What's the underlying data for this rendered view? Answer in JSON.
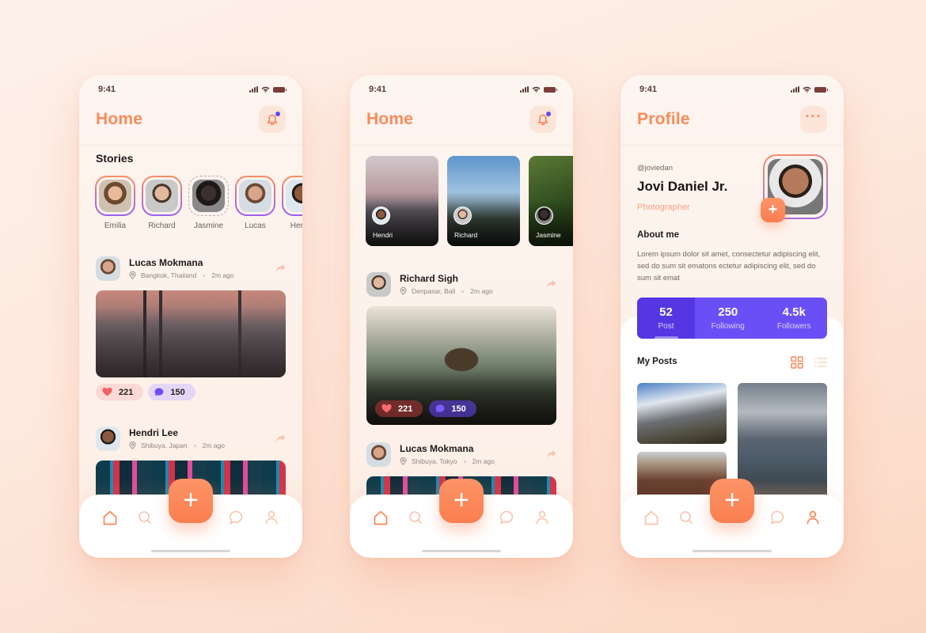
{
  "status_bar": {
    "time": "9:41"
  },
  "colors": {
    "accent": "#fa8a5c",
    "purple": "#6a4ff7",
    "like_bg": "#fbdad5",
    "comment_bg": "#e4d6f6"
  },
  "screens": [
    {
      "title": "Home",
      "stories_title": "Stories",
      "stories": [
        {
          "name": "Emilia",
          "seen": false
        },
        {
          "name": "Richard",
          "seen": false
        },
        {
          "name": "Jasmine",
          "seen": true
        },
        {
          "name": "Lucas",
          "seen": false
        },
        {
          "name": "Hendri",
          "seen": false
        }
      ],
      "posts": [
        {
          "author": "Lucas Mokmana",
          "location": "Bangkok, Thailand",
          "time": "2m ago",
          "likes": "221",
          "comments": "150"
        },
        {
          "author": "Hendri Lee",
          "location": "Shibuya, Japan",
          "time": "2m ago"
        }
      ]
    },
    {
      "title": "Home",
      "story_cards": [
        {
          "name": "Hendri"
        },
        {
          "name": "Richard"
        },
        {
          "name": "Jasmine"
        }
      ],
      "posts": [
        {
          "author": "Richard Sigh",
          "location": "Denpasar, Bali",
          "time": "2m ago",
          "likes": "221",
          "comments": "150"
        },
        {
          "author": "Lucas Mokmana",
          "location": "Shibuya, Tokyo",
          "time": "2m ago"
        }
      ]
    },
    {
      "title": "Profile",
      "handle": "@joviedan",
      "name": "Jovi Daniel Jr.",
      "role": "Photographer",
      "about_title": "About me",
      "about_text": "Lorem ipsum dolor sit amet, consectetur adipiscing elit, sed do sum sit ematons ectetur adipiscing elit, sed do sum sit emat",
      "stats": [
        {
          "value": "52",
          "label": "Post",
          "active": true
        },
        {
          "value": "250",
          "label": "Following",
          "active": false
        },
        {
          "value": "4.5k",
          "label": "Followers",
          "active": false
        }
      ],
      "my_posts_title": "My Posts",
      "view_mode": "grid"
    }
  ],
  "nav": {
    "items": [
      {
        "icon": "home-icon",
        "label": "Home"
      },
      {
        "icon": "search-icon",
        "label": "Search"
      },
      {
        "icon": "plus-icon",
        "label": "Add"
      },
      {
        "icon": "chat-icon",
        "label": "Messages"
      },
      {
        "icon": "profile-icon",
        "label": "Profile"
      }
    ],
    "fab_symbol": "+"
  }
}
